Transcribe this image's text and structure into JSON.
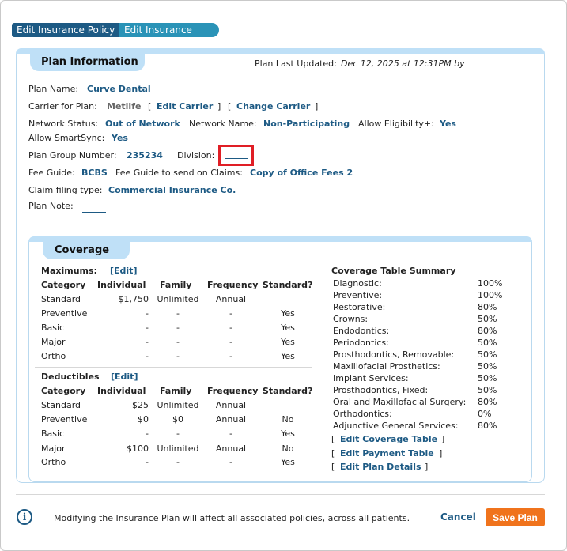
{
  "tabs": [
    "Edit Insurance Policy",
    "Edit Insurance Plan"
  ],
  "plan": {
    "header": "Plan Information",
    "last_updated_label": "Plan Last Updated:",
    "last_updated_value": "Dec 12, 2025 at 12:31PM by",
    "plan_name_label": "Plan Name:",
    "plan_name": "Curve Dental",
    "carrier_label": "Carrier for Plan:",
    "carrier": "Metlife",
    "edit_carrier": "Edit Carrier",
    "change_carrier": "Change Carrier",
    "network_status_label": "Network Status:",
    "network_status": "Out of Network",
    "network_name_label": "Network Name:",
    "network_name": "Non-Participating",
    "allow_elig_label": "Allow Eligibility+:",
    "allow_elig": "Yes",
    "allow_sync_label": "Allow SmartSync:",
    "allow_sync": "Yes",
    "group_number_label": "Plan Group Number:",
    "group_number": "235234",
    "division_label": "Division:",
    "fee_guide_label": "Fee Guide:",
    "fee_guide": "BCBS",
    "fee_claims_label": "Fee Guide to send on Claims:",
    "fee_claims": "Copy of Office Fees 2",
    "claim_type_label": "Claim filing type:",
    "claim_type": "Commercial Insurance Co.",
    "plan_note_label": "Plan Note:"
  },
  "coverage": {
    "header": "Coverage",
    "maximums_title": "Maximums:",
    "deductibles_title": "Deductibles",
    "edit_label": "[Edit]",
    "columns": [
      "Category",
      "Individual",
      "Family",
      "Frequency",
      "Standard?"
    ],
    "maximums": [
      [
        "Standard",
        "$1,750",
        "Unlimited",
        "Annual",
        ""
      ],
      [
        "Preventive",
        "-",
        "-",
        "-",
        "Yes"
      ],
      [
        "Basic",
        "-",
        "-",
        "-",
        "Yes"
      ],
      [
        "Major",
        "-",
        "-",
        "-",
        "Yes"
      ],
      [
        "Ortho",
        "-",
        "-",
        "-",
        "Yes"
      ]
    ],
    "deductibles": [
      [
        "Standard",
        "$25",
        "Unlimited",
        "Annual",
        ""
      ],
      [
        "Preventive",
        "$0",
        "$0",
        "Annual",
        "No"
      ],
      [
        "Basic",
        "-",
        "-",
        "-",
        "Yes"
      ],
      [
        "Major",
        "$100",
        "Unlimited",
        "Annual",
        "No"
      ],
      [
        "Ortho",
        "-",
        "-",
        "-",
        "Yes"
      ]
    ],
    "summary_title": "Coverage Table Summary",
    "summary": [
      [
        "Diagnostic:",
        "100%"
      ],
      [
        "Preventive:",
        "100%"
      ],
      [
        "Restorative:",
        "80%"
      ],
      [
        "Crowns:",
        "50%"
      ],
      [
        "Endodontics:",
        "80%"
      ],
      [
        "Periodontics:",
        "50%"
      ],
      [
        "Prosthodontics, Removable:",
        "50%"
      ],
      [
        "Maxillofacial Prosthetics:",
        "50%"
      ],
      [
        "Implant Services:",
        "50%"
      ],
      [
        "Prosthodontics, Fixed:",
        "50%"
      ],
      [
        "Oral and Maxillofacial Surgery:",
        "80%"
      ],
      [
        "Orthodontics:",
        "0%"
      ],
      [
        "Adjunctive General Services:",
        "80%"
      ]
    ],
    "edit_coverage_table": "Edit Coverage Table",
    "edit_payment_table": "Edit Payment Table",
    "edit_plan_details": "Edit Plan Details"
  },
  "footer": {
    "message": "Modifying the Insurance Plan will affect all associated policies, across all patients.",
    "cancel": "Cancel",
    "save": "Save Plan"
  },
  "colors": {
    "accent": "#1d5a84",
    "tab_active": "#2a93b7",
    "panel_header": "#bfe0f7",
    "save_button": "#f0731c",
    "highlight_box": "#e01e25"
  }
}
